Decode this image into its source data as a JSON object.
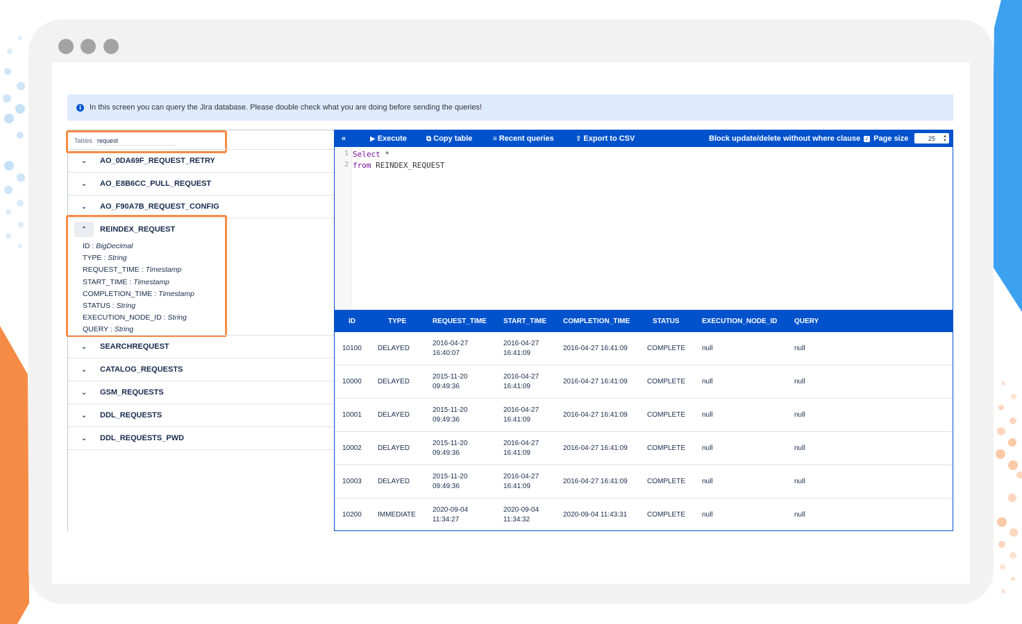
{
  "colors": {
    "accent": "#0052cc",
    "highlight": "#f68b45",
    "banner_bg": "#deebff"
  },
  "banner": {
    "text": "In this screen you can query the Jira database. Please double check what you are doing before sending the queries!"
  },
  "search": {
    "label": "Tables",
    "value": "request"
  },
  "tables": [
    {
      "name": "AO_0DA69F_REQUEST_RETRY"
    },
    {
      "name": "AO_E8B6CC_PULL_REQUEST"
    },
    {
      "name": "AO_F90A7B_REQUEST_CONFIG"
    }
  ],
  "expanded_table": {
    "name": "REINDEX_REQUEST",
    "fields": [
      {
        "name": "ID",
        "type": "BigDecimal"
      },
      {
        "name": "TYPE",
        "type": "String"
      },
      {
        "name": "REQUEST_TIME",
        "type": "Timestamp"
      },
      {
        "name": "START_TIME",
        "type": "Timestamp"
      },
      {
        "name": "COMPLETION_TIME",
        "type": "Timestamp"
      },
      {
        "name": "STATUS",
        "type": "String"
      },
      {
        "name": "EXECUTION_NODE_ID",
        "type": "String"
      },
      {
        "name": "QUERY",
        "type": "String"
      }
    ]
  },
  "tables_after": [
    {
      "name": "SEARCHREQUEST"
    },
    {
      "name": "CATALOG_REQUESTS"
    },
    {
      "name": "GSM_REQUESTS"
    },
    {
      "name": "DDL_REQUESTS"
    },
    {
      "name": "DDL_REQUESTS_PWD"
    }
  ],
  "toolbar": {
    "collapse": "«",
    "execute": "Execute",
    "copy_table": "Copy table",
    "recent_queries": "Recent queries",
    "export_csv": "Export to CSV",
    "block_label": "Block update/delete without where clause",
    "page_size_label": "Page size",
    "page_size_value": "25"
  },
  "editor": {
    "lines": [
      {
        "num": "1",
        "keyword": "Select",
        "rest": " *"
      },
      {
        "num": "2",
        "keyword": "from",
        "rest": " REINDEX_REQUEST"
      }
    ]
  },
  "results": {
    "columns": [
      "ID",
      "TYPE",
      "REQUEST_TIME",
      "START_TIME",
      "COMPLETION_TIME",
      "STATUS",
      "EXECUTION_NODE_ID",
      "QUERY"
    ],
    "rows": [
      [
        "10100",
        "DELAYED",
        "2016-04-27 16:40:07",
        "2016-04-27 16:41:09",
        "2016-04-27 16:41:09",
        "COMPLETE",
        "null",
        "null"
      ],
      [
        "10000",
        "DELAYED",
        "2015-11-20 09:49:36",
        "2016-04-27 16:41:09",
        "2016-04-27 16:41:09",
        "COMPLETE",
        "null",
        "null"
      ],
      [
        "10001",
        "DELAYED",
        "2015-11-20 09:49:36",
        "2016-04-27 16:41:09",
        "2016-04-27 16:41:09",
        "COMPLETE",
        "null",
        "null"
      ],
      [
        "10002",
        "DELAYED",
        "2015-11-20 09:49:36",
        "2016-04-27 16:41:09",
        "2016-04-27 16:41:09",
        "COMPLETE",
        "null",
        "null"
      ],
      [
        "10003",
        "DELAYED",
        "2015-11-20 09:49:36",
        "2016-04-27 16:41:09",
        "2016-04-27 16:41:09",
        "COMPLETE",
        "null",
        "null"
      ],
      [
        "10200",
        "IMMEDIATE",
        "2020-09-04 11:34:27",
        "2020-09-04 11:34:32",
        "2020-09-04 11:43:31",
        "COMPLETE",
        "null",
        "null"
      ]
    ]
  }
}
